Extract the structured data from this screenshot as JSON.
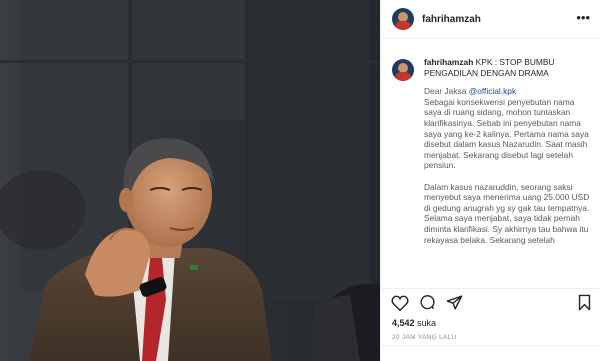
{
  "post": {
    "username": "fahrihamzah",
    "more_glyph": "•••",
    "caption": {
      "title_text": "KPK : STOP BUMBU PENGADILAN DENGAN DRAMA",
      "greeting_prefix": "Dear Jaksa ",
      "mention": "@official.kpk",
      "body": "Sebagai konsekwensi penyebutan nama saya di ruang sidang, mohon tuntaskan klarifikasinya. Sebab ini penyebutan nama saya yang ke-2 kalinya. Pertama nama saya disebut dalam kasus Nazarudin. Saat masih menjabat. Sekarang disebut lagi setelah pensiun.\n\nDalam kasus nazaruddin, seorang saksi menyebut saya menerima uang 25.000 USD di gedung anugrah yg sy gak tau tempatnya. Selama saya menjabat, saya tidak pernah diminta klarifikasi. Sy akhirnya tau bahwa itu rekayasa belaka. Sekarang setelah"
    },
    "likes_count": "4,542",
    "likes_label": "suka",
    "timestamp": "20 JAM YANG LALU"
  },
  "icons": {
    "like": "heart-icon",
    "comment": "comment-icon",
    "share": "paper-plane-icon",
    "save": "bookmark-icon",
    "options": "more-options-icon"
  },
  "colors": {
    "mention": "#1a4b9a",
    "border": "#efefef",
    "muted": "#8e8e8e"
  }
}
